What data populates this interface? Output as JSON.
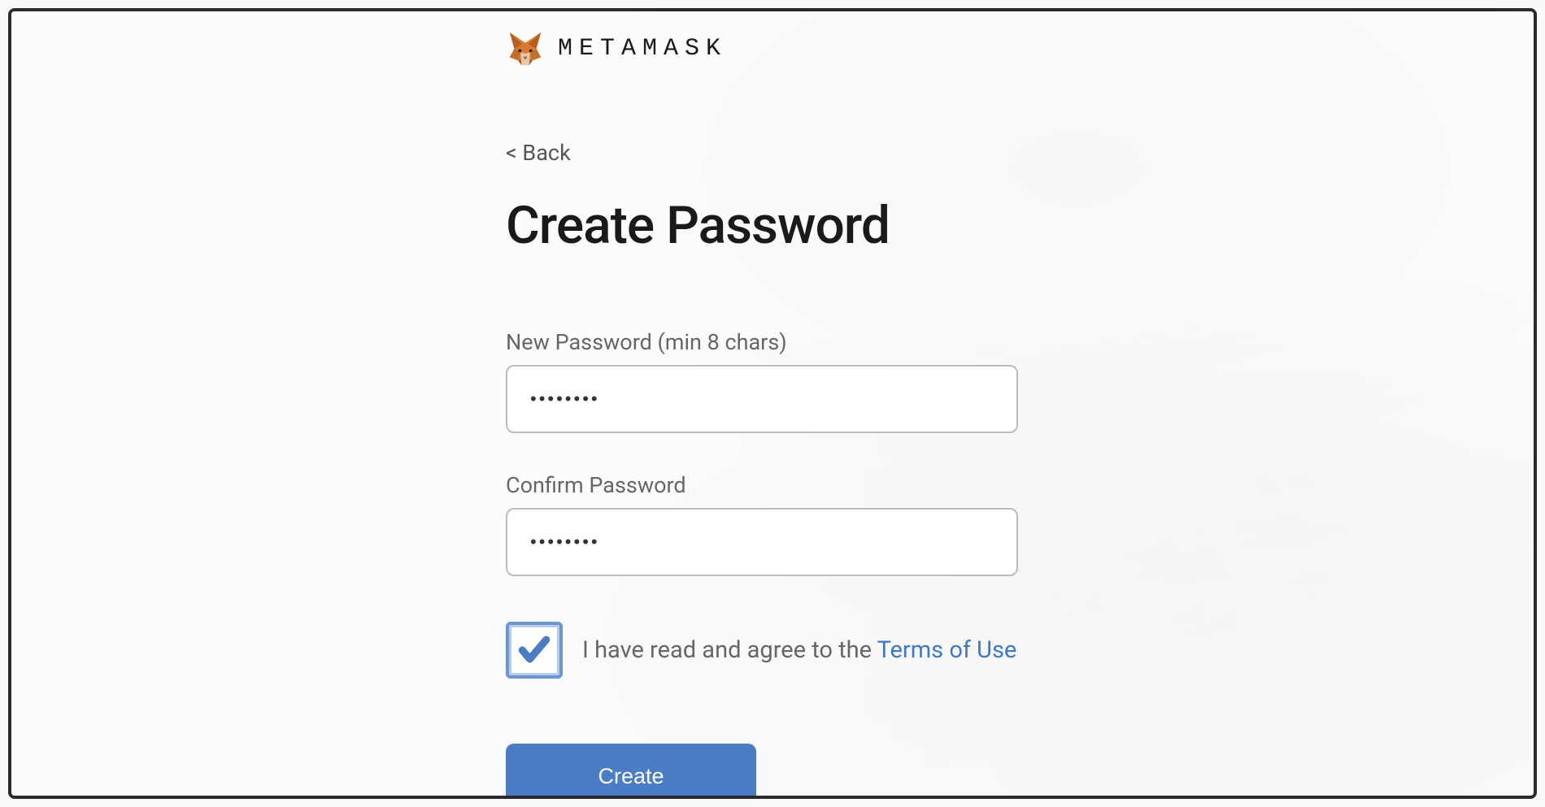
{
  "brand": {
    "name": "METAMASK"
  },
  "nav": {
    "back_label": "< Back"
  },
  "page": {
    "title": "Create Password"
  },
  "form": {
    "new_password": {
      "label": "New Password (min 8 chars)",
      "value": "••••••••"
    },
    "confirm_password": {
      "label": "Confirm Password",
      "value": "••••••••"
    },
    "terms": {
      "prefix": "I have read and agree to the ",
      "link_text": "Terms of Use",
      "checked": true
    },
    "submit_label": "Create"
  },
  "colors": {
    "primary": "#4b7dc7",
    "link": "#3d78c9",
    "text_muted": "#666",
    "border": "#bcbcbc"
  }
}
